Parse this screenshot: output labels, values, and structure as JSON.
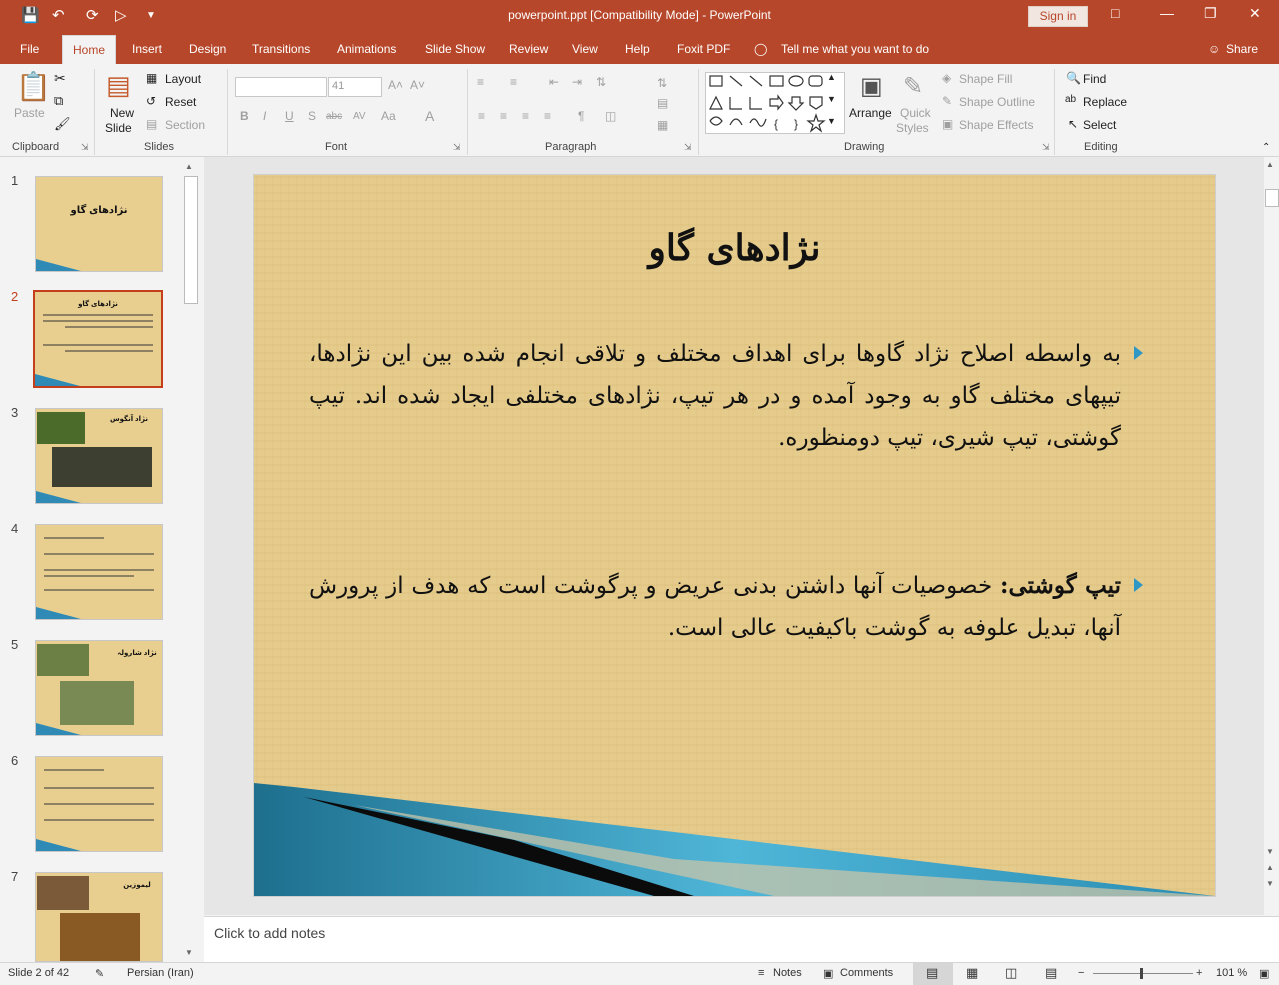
{
  "app": {
    "doc_title": "powerpoint.ppt [Compatibility Mode]  -  PowerPoint",
    "sign_in": "Sign in",
    "share": "Share",
    "tell_me": "Tell me what you want to do"
  },
  "tabs": [
    "File",
    "Home",
    "Insert",
    "Design",
    "Transitions",
    "Animations",
    "Slide Show",
    "Review",
    "View",
    "Help",
    "Foxit PDF"
  ],
  "ribbon": {
    "clipboard": {
      "label": "Clipboard",
      "paste": "Paste"
    },
    "slides": {
      "label": "Slides",
      "new_slide": "New",
      "new_slide2": "Slide",
      "layout": "Layout",
      "reset": "Reset",
      "section": "Section"
    },
    "font": {
      "label": "Font",
      "font_name": "",
      "font_size": "41"
    },
    "paragraph": {
      "label": "Paragraph"
    },
    "drawing": {
      "label": "Drawing",
      "arrange": "Arrange",
      "quick": "Quick",
      "styles": "Styles",
      "shape_fill": "Shape Fill",
      "shape_outline": "Shape Outline",
      "shape_effects": "Shape Effects"
    },
    "editing": {
      "label": "Editing",
      "find": "Find",
      "replace": "Replace",
      "select": "Select"
    }
  },
  "thumbnails": [
    {
      "num": "1",
      "title": "نژادهای گاو"
    },
    {
      "num": "2",
      "title": "نژادهای گاو"
    },
    {
      "num": "3",
      "title": "نژاد آنگوس"
    },
    {
      "num": "4",
      "title": ""
    },
    {
      "num": "5",
      "title": "نژاد شارولہ"
    },
    {
      "num": "6",
      "title": ""
    },
    {
      "num": "7",
      "title": "لیموزین"
    }
  ],
  "slide": {
    "title": "نژادهای گاو",
    "bullet1": "به واسطه اصلاح نژاد گاوها برای اهداف مختلف و تلاقی انجام شده بین این نژادها، تیپهای مختلف گاو به وجود آمده و در هر تیپ، نژادهای مختلفی ایجاد شده اند. تیپ گوشتی، تیپ شیری، تیپ دومنظوره.",
    "bullet2_bold": "تیپ گوشتی:",
    "bullet2_rest": " خصوصیات آنها داشتن بدنی عریض و پرگوشت است که هدف از پرورش آنها، تبدیل علوفه به گوشت باکیفیت عالی است."
  },
  "notes_placeholder": "Click to add notes",
  "status": {
    "slide_of": "Slide 2 of 42",
    "language": "Persian (Iran)",
    "notes": "Notes",
    "comments": "Comments",
    "zoom": "101 %"
  },
  "colors": {
    "accent": "#b7472a",
    "slide_bg": "#e6cc8c",
    "bullet": "#2e97c4"
  }
}
